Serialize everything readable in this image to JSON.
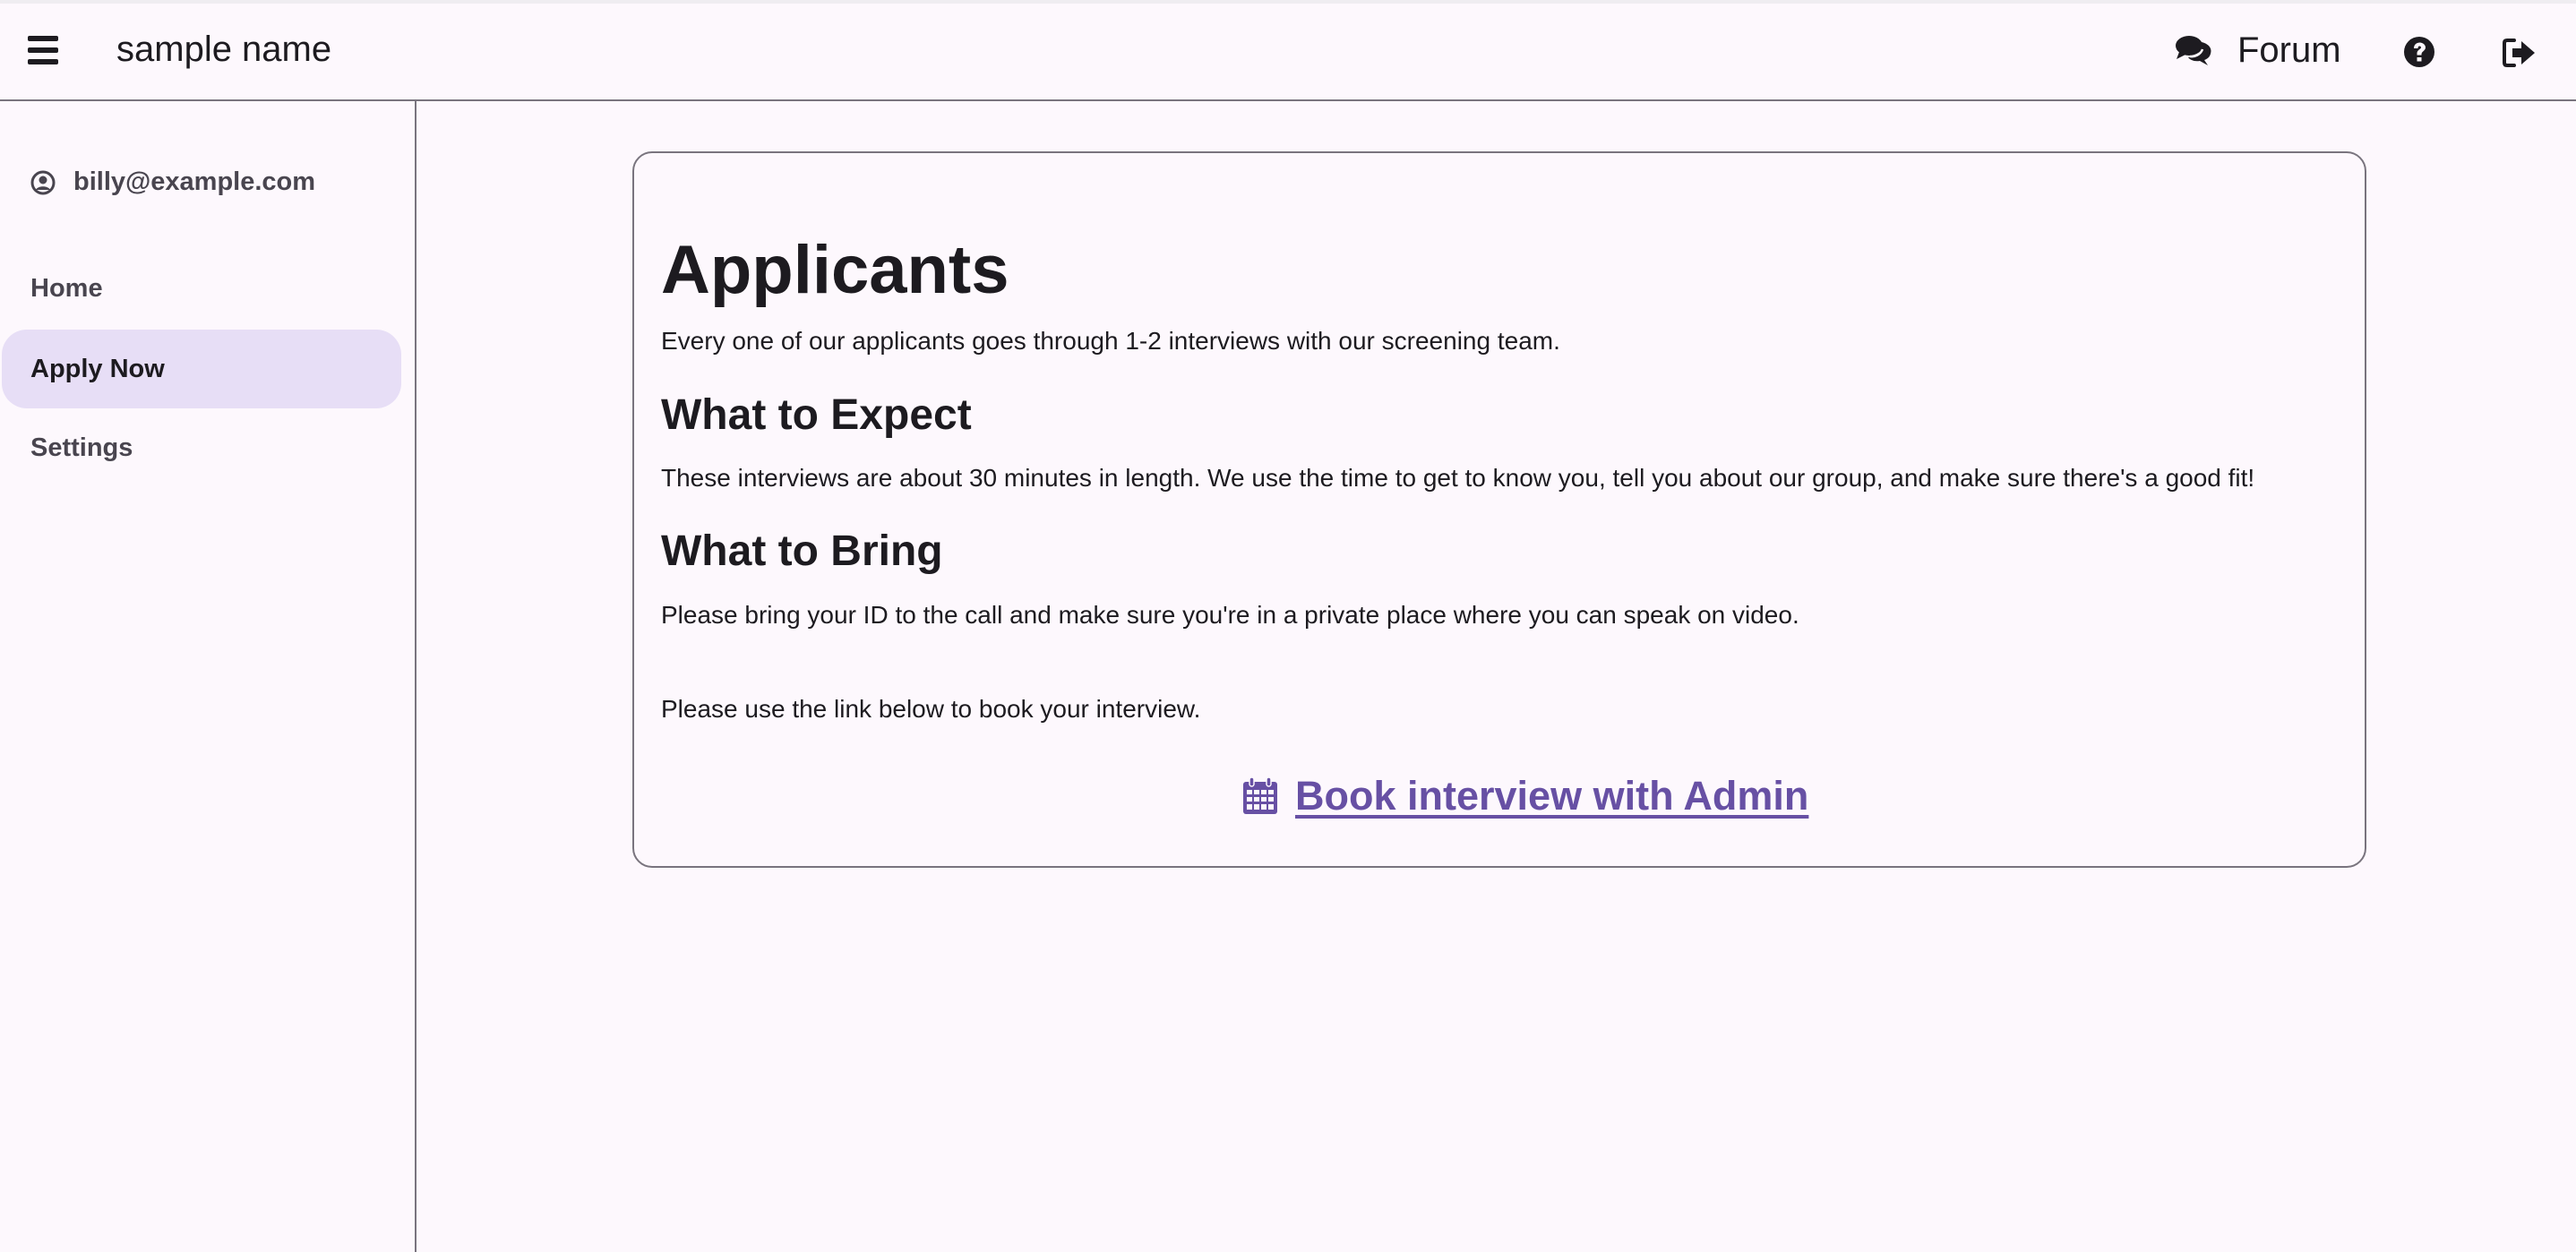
{
  "header": {
    "menu_icon": "hamburger-menu-icon",
    "app_title": "sample name",
    "forum": {
      "icon": "comments-icon",
      "label": "Forum"
    },
    "help_icon": "question-circle-icon",
    "logout_icon": "sign-out-icon"
  },
  "sidebar": {
    "user": {
      "icon": "user-circle-icon",
      "email": "billy@example.com"
    },
    "items": [
      {
        "label": "Home",
        "active": false
      },
      {
        "label": "Apply Now",
        "active": true
      },
      {
        "label": "Settings",
        "active": false
      }
    ]
  },
  "content": {
    "title": "Applicants",
    "intro": "Every one of our applicants goes through 1-2 interviews with our screening team.",
    "sections": [
      {
        "heading": "What to Expect",
        "body": "These interviews are about 30 minutes in length. We use the time to get to know you, tell you about our group, and make sure there's a good fit!"
      },
      {
        "heading": "What to Bring",
        "body": "Please bring your ID to the call and make sure you're in a private place where you can speak on video."
      }
    ],
    "booking_prompt": "Please use the link below to book your interview.",
    "booking_link": {
      "icon": "calendar-icon",
      "label": "Book interview with Admin"
    }
  },
  "colors": {
    "background": "#fdf8fd",
    "accent": "#6750a4",
    "active_nav": "#e7def6",
    "border": "#79747e",
    "text": "#1d1b20"
  }
}
